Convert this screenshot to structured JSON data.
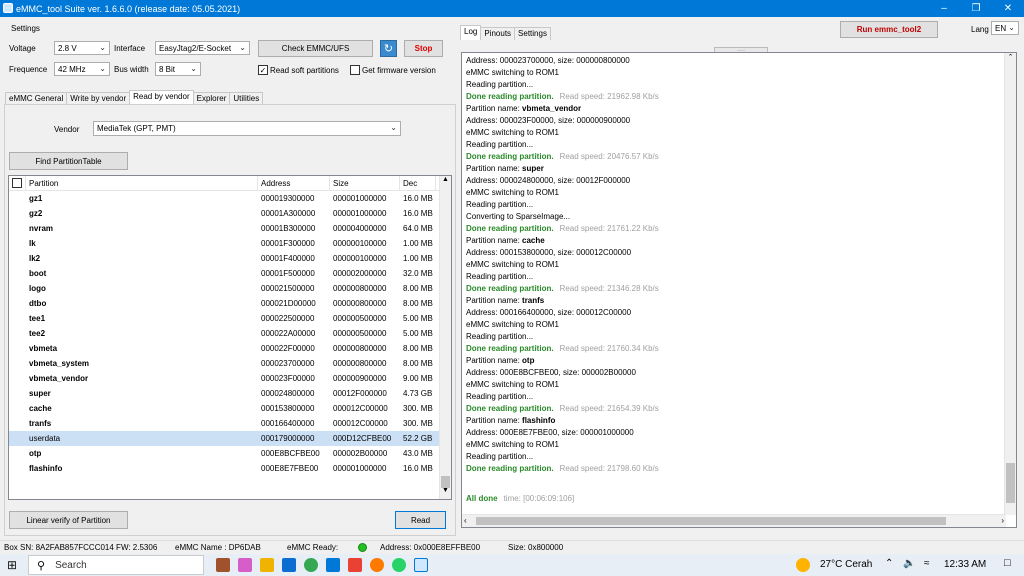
{
  "window": {
    "title": "eMMC_tool Suite  ver. 1.6.6.0 (release date: 05.05.2021)"
  },
  "settings": {
    "group_label": "Settings",
    "voltage_label": "Voltage",
    "voltage_value": "2.8 V",
    "interface_label": "Interface",
    "interface_value": "EasyJtag2/E-Socket",
    "check_button": "Check EMMC/UFS",
    "stop_button": "Stop",
    "frequence_label": "Frequence",
    "frequence_value": "42 MHz",
    "buswidth_label": "Bus width",
    "buswidth_value": "8 Bit",
    "read_soft_label": "Read soft partitions",
    "read_soft_checked": true,
    "get_fw_label": "Get firmware version",
    "get_fw_checked": false
  },
  "left_tabs": [
    "eMMC General",
    "Write by vendor",
    "Read by vendor",
    "Explorer",
    "Utilities"
  ],
  "vendor": {
    "label": "Vendor",
    "value": "MediaTek (GPT, PMT)"
  },
  "find_button": "Find PartitionTable",
  "table": {
    "headers": [
      "Partition",
      "Address",
      "Size",
      "Dec"
    ],
    "rows": [
      {
        "name": "gz1",
        "address": "000019300000",
        "size": "000001000000",
        "dec": "16.0 MB",
        "checked": true
      },
      {
        "name": "gz2",
        "address": "00001A300000",
        "size": "000001000000",
        "dec": "16.0 MB",
        "checked": true
      },
      {
        "name": "nvram",
        "address": "00001B300000",
        "size": "000004000000",
        "dec": "64.0 MB",
        "checked": true
      },
      {
        "name": "lk",
        "address": "00001F300000",
        "size": "000000100000",
        "dec": "1.00 MB",
        "checked": true
      },
      {
        "name": "lk2",
        "address": "00001F400000",
        "size": "000000100000",
        "dec": "1.00 MB",
        "checked": true
      },
      {
        "name": "boot",
        "address": "00001F500000",
        "size": "000002000000",
        "dec": "32.0 MB",
        "checked": true
      },
      {
        "name": "logo",
        "address": "000021500000",
        "size": "000000800000",
        "dec": "8.00 MB",
        "checked": true
      },
      {
        "name": "dtbo",
        "address": "000021D00000",
        "size": "000000800000",
        "dec": "8.00 MB",
        "checked": true
      },
      {
        "name": "tee1",
        "address": "000022500000",
        "size": "000000500000",
        "dec": "5.00 MB",
        "checked": true
      },
      {
        "name": "tee2",
        "address": "000022A00000",
        "size": "000000500000",
        "dec": "5.00 MB",
        "checked": true
      },
      {
        "name": "vbmeta",
        "address": "000022F00000",
        "size": "000000800000",
        "dec": "8.00 MB",
        "checked": true
      },
      {
        "name": "vbmeta_system",
        "address": "000023700000",
        "size": "000000800000",
        "dec": "8.00 MB",
        "checked": true
      },
      {
        "name": "vbmeta_vendor",
        "address": "000023F00000",
        "size": "000000900000",
        "dec": "9.00 MB",
        "checked": true
      },
      {
        "name": "super",
        "address": "000024800000",
        "size": "00012F000000",
        "dec": "4.73 GB",
        "checked": true
      },
      {
        "name": "cache",
        "address": "000153800000",
        "size": "000012C00000",
        "dec": "300. MB",
        "checked": true
      },
      {
        "name": "tranfs",
        "address": "000166400000",
        "size": "000012C00000",
        "dec": "300. MB",
        "checked": true
      },
      {
        "name": "userdata",
        "address": "000179000000",
        "size": "000D12CFBE00",
        "dec": "52.2 GB",
        "checked": false,
        "selected": true
      },
      {
        "name": "otp",
        "address": "000E8BCFBE00",
        "size": "000002B00000",
        "dec": "43.0 MB",
        "checked": true
      },
      {
        "name": "flashinfo",
        "address": "000E8E7FBE00",
        "size": "000001000000",
        "dec": "16.0 MB",
        "checked": true
      }
    ]
  },
  "linear_button": "Linear verify of Partition",
  "read_button": "Read",
  "right_tabs": [
    "Log",
    "Pinouts",
    "Settings"
  ],
  "run_button": "Run emmc_tool2",
  "lang": {
    "label": "Lang",
    "value": "EN"
  },
  "log": [
    {
      "t": "Address: 000023700000, size: 000000800000"
    },
    {
      "t": "eMMC switching to ROM1"
    },
    {
      "t": "Reading partition..."
    },
    {
      "g": "Done reading partition.",
      "s": "Read speed: 21962.98 Kb/s"
    },
    {
      "t": "Partition name: ",
      "b": "vbmeta_vendor"
    },
    {
      "t": "Address: 000023F00000, size: 000000900000"
    },
    {
      "t": "eMMC switching to ROM1"
    },
    {
      "t": "Reading partition..."
    },
    {
      "g": "Done reading partition.",
      "s": "Read speed: 20476.57 Kb/s"
    },
    {
      "t": "Partition name: ",
      "b": "super"
    },
    {
      "t": "Address: 000024800000, size: 00012F000000"
    },
    {
      "t": "eMMC switching to ROM1"
    },
    {
      "t": "Reading partition..."
    },
    {
      "t": "Converting to SparseImage..."
    },
    {
      "g": "Done reading partition.",
      "s": "Read speed: 21761.22 Kb/s"
    },
    {
      "t": "Partition name: ",
      "b": "cache"
    },
    {
      "t": "Address: 000153800000, size: 000012C00000"
    },
    {
      "t": "eMMC switching to ROM1"
    },
    {
      "t": "Reading partition..."
    },
    {
      "g": "Done reading partition.",
      "s": "Read speed: 21346.28 Kb/s"
    },
    {
      "t": "Partition name: ",
      "b": "tranfs"
    },
    {
      "t": "Address: 000166400000, size: 000012C00000"
    },
    {
      "t": "eMMC switching to ROM1"
    },
    {
      "t": "Reading partition..."
    },
    {
      "g": "Done reading partition.",
      "s": "Read speed: 21760.34 Kb/s"
    },
    {
      "t": "Partition name: ",
      "b": "otp"
    },
    {
      "t": "Address: 000E8BCFBE00, size: 000002B00000"
    },
    {
      "t": "eMMC switching to ROM1"
    },
    {
      "t": "Reading partition..."
    },
    {
      "g": "Done reading partition.",
      "s": "Read speed: 21654.39 Kb/s"
    },
    {
      "t": "Partition name: ",
      "b": "flashinfo"
    },
    {
      "t": "Address: 000E8E7FBE00, size: 000001000000"
    },
    {
      "t": "eMMC switching to ROM1"
    },
    {
      "t": "Reading partition..."
    },
    {
      "g": "Done reading partition.",
      "s": "Read speed: 21798.60 Kb/s"
    },
    {
      "t": ""
    },
    {
      "g": "All done",
      "s": "time: [00:06:09:106]"
    }
  ],
  "status": {
    "box_sn": "Box SN:  8A2FAB857FCCC014  FW:  2.5306",
    "emmc_name": "eMMC Name : DP6DAB",
    "emmc_ready": "eMMC Ready:",
    "address": "Address: 0x000E8EFFBE00",
    "size": "Size: 0x800000"
  },
  "taskbar": {
    "search": "Search",
    "weather": "27°C  Cerah",
    "time": "12:33 AM"
  },
  "colors": {
    "titlebar": "#0078d7",
    "stop": "#e00000",
    "done": "#2a8a2a",
    "selected_row": "#cce0f5"
  }
}
